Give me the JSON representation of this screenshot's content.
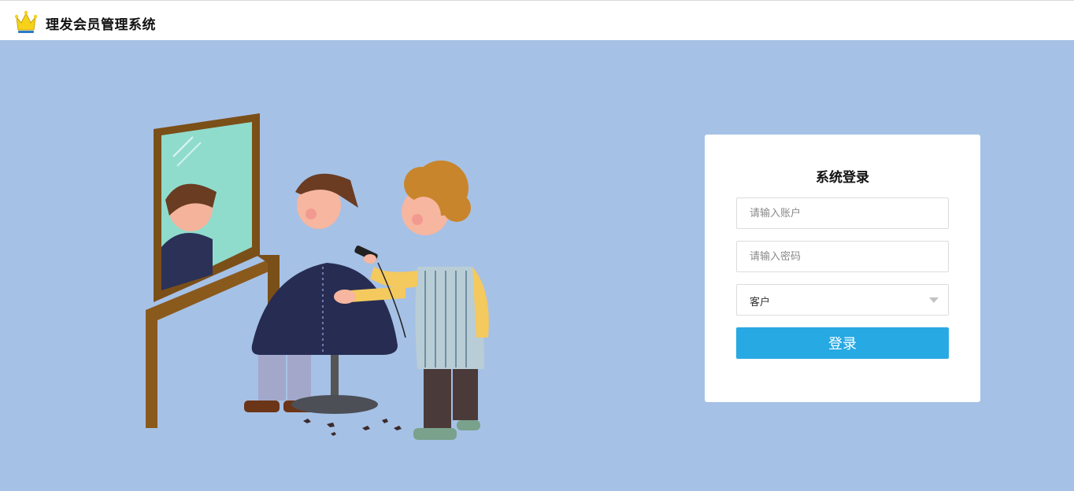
{
  "header": {
    "title": "理发会员管理系统",
    "logo_icon": "crown-icon"
  },
  "login": {
    "title": "系统登录",
    "username": {
      "placeholder": "请输入账户",
      "value": ""
    },
    "password": {
      "placeholder": "请输入密码",
      "value": ""
    },
    "role": {
      "selected": "客户"
    },
    "submit_label": "登录"
  },
  "colors": {
    "background": "#a6c1e6",
    "primary_button": "#27a9e3",
    "card": "#ffffff"
  }
}
